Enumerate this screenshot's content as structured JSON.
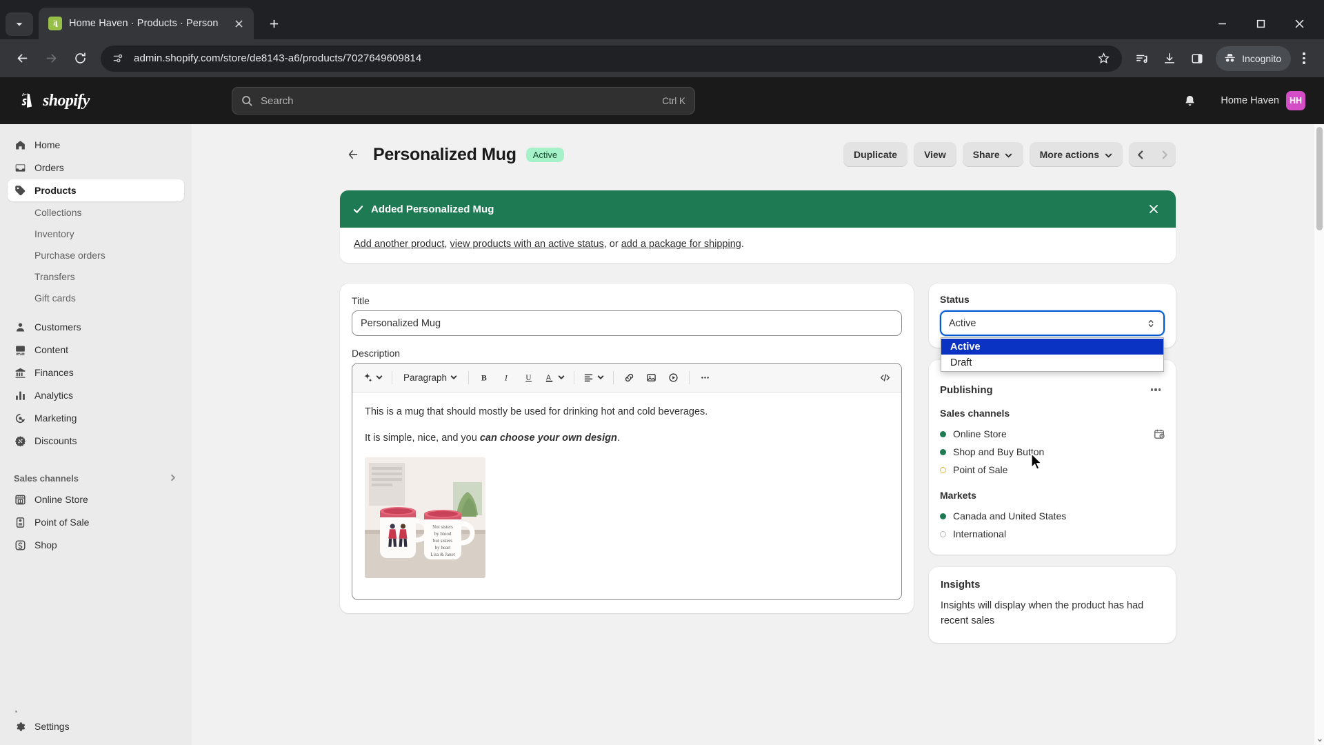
{
  "browser": {
    "tab": {
      "title": "Home Haven · Products · Person",
      "favicon": "shopify-icon"
    },
    "new_tab_label": "+",
    "url": "admin.shopify.com/store/de8143-a6/products/7027649609814",
    "profile_label": "Incognito",
    "icons": {
      "back": "back-arrow-icon",
      "forward": "forward-arrow-icon",
      "reload": "reload-icon",
      "site_info": "site-settings-icon",
      "bookmark": "star-icon",
      "reading_list": "reading-list-icon",
      "downloads": "download-icon",
      "side_panel": "side-panel-icon",
      "menu": "kebab-menu-icon",
      "minimize": "minimize-icon",
      "maximize": "maximize-icon",
      "close": "close-icon"
    }
  },
  "shopify_header": {
    "brand": "shopify",
    "search_placeholder": "Search",
    "search_shortcut": "Ctrl K",
    "store_name": "Home Haven",
    "store_initials": "HH"
  },
  "sidebar": {
    "primary": [
      {
        "label": "Home",
        "icon": "home-icon",
        "active": false
      },
      {
        "label": "Orders",
        "icon": "orders-inbox-icon",
        "active": false
      },
      {
        "label": "Products",
        "icon": "products-tag-icon",
        "active": true
      }
    ],
    "product_subitems": [
      {
        "label": "Collections"
      },
      {
        "label": "Inventory"
      },
      {
        "label": "Purchase orders"
      },
      {
        "label": "Transfers"
      },
      {
        "label": "Gift cards"
      }
    ],
    "secondary": [
      {
        "label": "Customers",
        "icon": "customers-person-icon"
      },
      {
        "label": "Content",
        "icon": "content-image-icon"
      },
      {
        "label": "Finances",
        "icon": "finances-bank-icon"
      },
      {
        "label": "Analytics",
        "icon": "analytics-bars-icon"
      },
      {
        "label": "Marketing",
        "icon": "marketing-target-icon"
      },
      {
        "label": "Discounts",
        "icon": "discounts-badge-icon"
      }
    ],
    "sales_channels_header": "Sales channels",
    "sales_channels": [
      {
        "label": "Online Store",
        "icon": "online-store-icon"
      },
      {
        "label": "Point of Sale",
        "icon": "point-of-sale-icon"
      },
      {
        "label": "Shop",
        "icon": "shop-bag-icon"
      }
    ],
    "settings": {
      "label": "Settings",
      "icon": "settings-gear-icon"
    }
  },
  "page": {
    "title": "Personalized Mug",
    "status_badge": "Active",
    "back_icon": "back-arrow-icon",
    "actions": [
      {
        "label": "Duplicate",
        "caret": false
      },
      {
        "label": "View",
        "caret": false
      },
      {
        "label": "Share",
        "caret": true
      },
      {
        "label": "More actions",
        "caret": true
      }
    ],
    "pager": {
      "prev_icon": "chevron-left-icon",
      "next_icon": "chevron-right-icon"
    }
  },
  "banner": {
    "icon": "check-icon",
    "title": "Added Personalized Mug",
    "close_icon": "close-icon",
    "links": [
      {
        "text": "Add another product"
      },
      {
        "text": "view products with an active status"
      },
      {
        "text": "add a package for shipping"
      }
    ],
    "sep1": ", ",
    "sep2": ", or ",
    "end": "."
  },
  "product_form": {
    "title_label": "Title",
    "title_value": "Personalized Mug",
    "description_label": "Description",
    "editor": {
      "tools": [
        {
          "name": "ai-magic-icon",
          "caret": true
        },
        {
          "name": "paragraph-style",
          "label": "Paragraph",
          "caret": true
        },
        {
          "name": "bold-icon",
          "glyph": "B"
        },
        {
          "name": "italic-icon",
          "glyph": "I"
        },
        {
          "name": "underline-icon",
          "glyph": "U"
        },
        {
          "name": "text-color-icon",
          "glyph": "A",
          "caret": true
        },
        {
          "name": "align-icon",
          "caret": true
        },
        {
          "name": "link-icon"
        },
        {
          "name": "insert-image-icon"
        },
        {
          "name": "insert-video-icon"
        },
        {
          "name": "more-options-icon"
        },
        {
          "name": "code-view-icon"
        }
      ]
    },
    "body_p1": "This is a mug that should mostly be used for drinking hot and cold beverages.",
    "body_p2_plain": "It is simple, nice, and you ",
    "body_p2_bold": "can choose your own design",
    "body_p2_end": ".",
    "image_alt": "personalized mug product photo"
  },
  "status_card": {
    "label": "Status",
    "selected": "Active",
    "options": [
      "Active",
      "Draft"
    ],
    "dropdown_open": true
  },
  "publishing": {
    "title": "Publishing",
    "menu_icon": "more-options-icon",
    "sales_channels_label": "Sales channels",
    "channels": [
      {
        "label": "Online Store",
        "state": "on",
        "has_schedule_icon": true
      },
      {
        "label": "Shop and Buy Button",
        "state": "on",
        "has_schedule_icon": false
      },
      {
        "label": "Point of Sale",
        "state": "warn",
        "has_schedule_icon": false
      }
    ],
    "markets_label": "Markets",
    "markets": [
      {
        "label": "Canada and United States",
        "state": "on"
      },
      {
        "label": "International",
        "state": "off"
      }
    ]
  },
  "insights": {
    "title": "Insights",
    "body": "Insights will display when the product has had recent sales"
  },
  "colors": {
    "shopify_green": "#95bf47",
    "banner_green": "#1d7a52",
    "badge_green": "#a6f2c8",
    "focus_blue": "#005bd3",
    "option_select_blue": "#0a33c4",
    "channel_on": "#1d7a52",
    "channel_warn": "#e0b341",
    "avatar_pink": "#d44dc6"
  }
}
